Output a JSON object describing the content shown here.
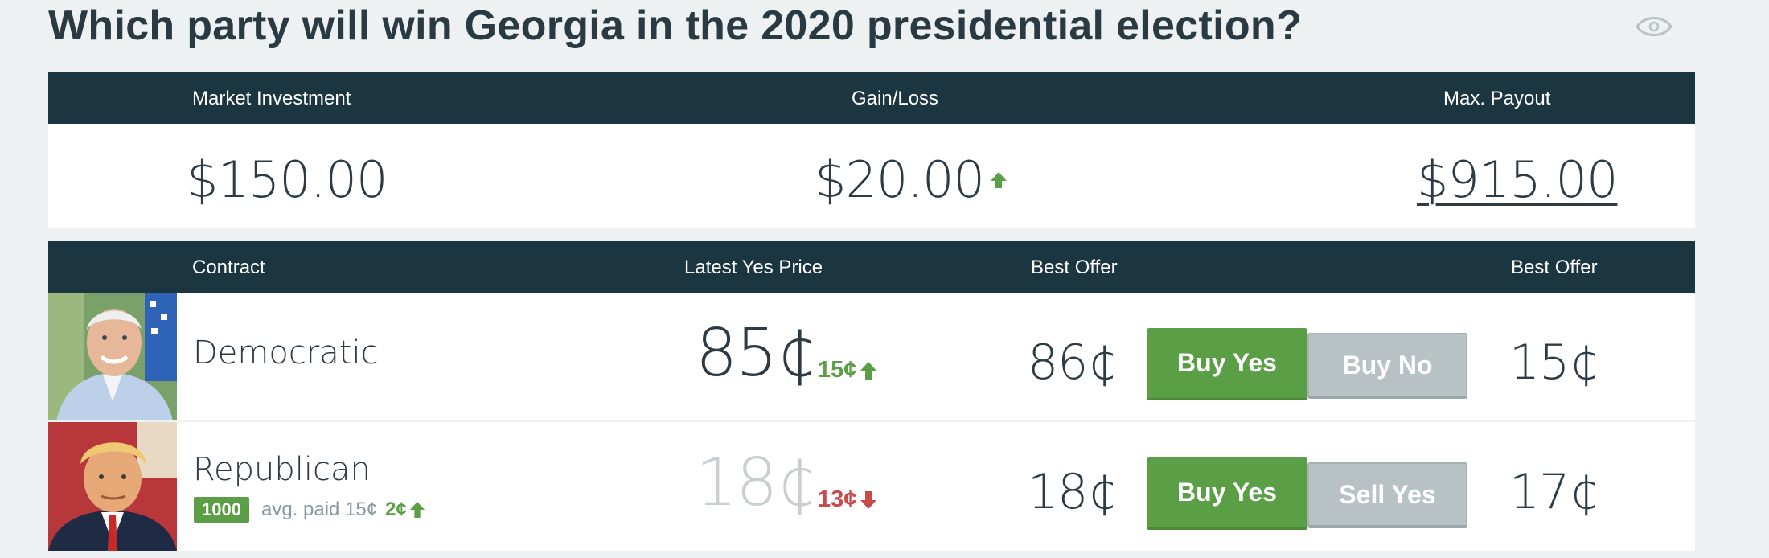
{
  "page": {
    "title": "Which party will win Georgia in the 2020 presidential election?"
  },
  "summary": {
    "headers": {
      "investment": "Market Investment",
      "gainloss": "Gain/Loss",
      "payout": "Max. Payout"
    },
    "investment": "$150.00",
    "gainloss": "$20.00",
    "payout": "$915.00"
  },
  "table": {
    "headers": {
      "contract": "Contract",
      "latest": "Latest Yes Price",
      "offer_yes": "Best Offer",
      "offer_no": "Best Offer"
    },
    "rows": [
      {
        "name": "Democratic",
        "latest": "85¢",
        "change": "15¢",
        "best_offer_yes": "86¢",
        "btn_primary": "Buy Yes",
        "btn_secondary": "Buy No",
        "best_offer_no": "15¢"
      },
      {
        "name": "Republican",
        "shares": "1000",
        "avg_paid": "avg. paid 15¢",
        "avg_change": "2¢",
        "latest": "18¢",
        "change": "13¢",
        "best_offer_yes": "18¢",
        "btn_primary": "Buy Yes",
        "btn_secondary": "Sell Yes",
        "best_offer_no": "17¢"
      }
    ]
  },
  "colors": {
    "header_bg": "#1b3640",
    "green": "#5a9e46",
    "red": "#c94a4a",
    "gray_button": "#b8c2c4"
  },
  "icons": [
    "eye-icon",
    "arrow-up-icon",
    "arrow-down-icon"
  ]
}
